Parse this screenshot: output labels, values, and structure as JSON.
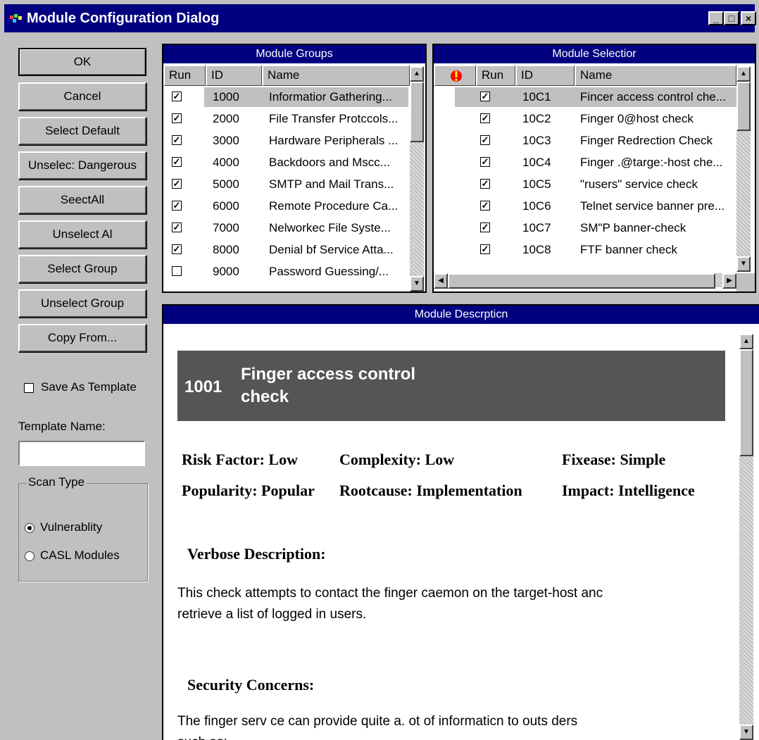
{
  "window": {
    "title": "Module Configuration Dialog",
    "controls": {
      "minimize": "_",
      "maximize": "□",
      "close": "×"
    }
  },
  "buttons": {
    "ok": "OK",
    "cancel": "Cancel",
    "select_default": "Select Default",
    "unselect_dangerous": "Unselec: Dangerous",
    "select_all": "SeectAll",
    "unselect_all": "Unselect Al",
    "select_group": "Select Group",
    "unselect_group": "Unselect Group",
    "copy_from": "Copy From..."
  },
  "template": {
    "save_as_template": "Save As Template",
    "save_as_template_checked": false,
    "template_name_label": "Template Name:",
    "template_name_value": ""
  },
  "scan_type": {
    "caption": "Scan Type",
    "options": [
      {
        "label": "Vulnerablity",
        "selected": true
      },
      {
        "label": "CASL Modules",
        "selected": false
      }
    ]
  },
  "module_groups": {
    "title": "Module Groups",
    "columns": [
      "Run",
      "ID",
      "Name"
    ],
    "rows": [
      {
        "run": true,
        "id": "1000",
        "name": "Informatior Gathering..."
      },
      {
        "run": true,
        "id": "2000",
        "name": "File Transfer Protccols..."
      },
      {
        "run": true,
        "id": "3000",
        "name": "Hardware Peripherals ..."
      },
      {
        "run": true,
        "id": "4000",
        "name": "Backdoors and Mscc..."
      },
      {
        "run": true,
        "id": "5000",
        "name": "SMTP and Mail Trans..."
      },
      {
        "run": true,
        "id": "6000",
        "name": "Remote Procedure Ca..."
      },
      {
        "run": true,
        "id": "7000",
        "name": "Nelworkec File Syste..."
      },
      {
        "run": true,
        "id": "8000",
        "name": "Denial bf Service Atta..."
      },
      {
        "run": false,
        "id": "9000",
        "name": "Password Guessing/..."
      }
    ]
  },
  "module_selection": {
    "title": "Module Selectior",
    "columns": [
      "!",
      "Run",
      "ID",
      "Name"
    ],
    "rows": [
      {
        "run": true,
        "id": "10C1",
        "name": "Fincer access control che..."
      },
      {
        "run": true,
        "id": "10C2",
        "name": "Finger 0@host check"
      },
      {
        "run": true,
        "id": "10C3",
        "name": "Finger Redrection Check"
      },
      {
        "run": true,
        "id": "10C4",
        "name": "Finger .@targe:-host che..."
      },
      {
        "run": true,
        "id": "10C5",
        "name": "\"rusers\" service check"
      },
      {
        "run": true,
        "id": "10C6",
        "name": "Telnet service banner pre..."
      },
      {
        "run": true,
        "id": "10C7",
        "name": "SM\"P banner-check"
      },
      {
        "run": true,
        "id": "10C8",
        "name": "FTF banner check"
      }
    ]
  },
  "description": {
    "title": "Module Descrpticn",
    "header_id": "1001",
    "header_name_line1": "Finger access control",
    "header_name_line2": "check",
    "attrs": {
      "risk": "Risk Factor: Low",
      "complexity": "Complexity: Low",
      "fixease": "Fixease: Simple",
      "popularity": "Popularity: Popular",
      "rootcause": "Rootcause: Implementation",
      "impact": "Impact: Intelligence"
    },
    "verbose_heading": "Verbose Description:",
    "verbose_line1": "This check attempts to contact the finger caemon on the target-host anc",
    "verbose_line2": "retrieve a list of logged in users.",
    "security_heading": "Security Concerns:",
    "security_line1": "The finger serv ce can provide quite a. ot of informaticn to outs ders",
    "security_line2": "such as:"
  },
  "colors": {
    "title_bar": "#000080",
    "face": "#c0c0c0",
    "desc_banner": "#555555"
  }
}
